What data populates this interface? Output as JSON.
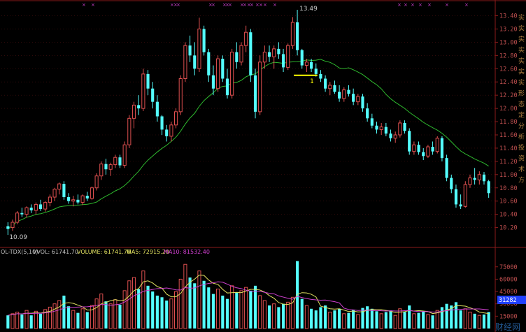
{
  "colors": {
    "background": "#000000",
    "frame": "#8b1a1a",
    "grid": "#4a1010",
    "up": "#e05050",
    "down": "#54ffff",
    "ma": "#2eb82e",
    "vol_ma5": "#e0e060",
    "vol_ma10": "#d040d0",
    "label": "#c05050",
    "marker": "#ffff00",
    "badge": "#2040ff"
  },
  "price_axis": {
    "ticks": [
      "13.40",
      "13.20",
      "13.00",
      "12.80",
      "12.60",
      "12.40",
      "12.20",
      "12.00",
      "11.80",
      "11.60",
      "11.40",
      "11.20",
      "11.00",
      "10.80",
      "10.60",
      "10.40",
      "10.20"
    ],
    "high_label": "13.49",
    "low_label": "10.09",
    "marker_label": "1"
  },
  "indicator_header": {
    "name": "OL-TDX(5,10)",
    "vvol": "VVOL: 61741.70",
    "volume": "VOLUME: 61741.70",
    "ma5": "MA5: 72915.20",
    "ma10": "MA10: 81532.40"
  },
  "volume_axis": {
    "ticks": [
      "75000",
      "60000",
      "45000",
      "30000",
      "15000"
    ],
    "badge": "31282"
  },
  "side_labels": [
    "实",
    "实",
    "实",
    "实",
    "实",
    "实",
    "实",
    "形",
    "态",
    "定",
    "分",
    "析",
    "投",
    "资",
    "术",
    "方"
  ],
  "watermark": "财经网",
  "chart_data": {
    "type": "candlestick",
    "price_range": [
      10.09,
      13.49
    ],
    "volume_range": [
      0,
      85000
    ],
    "ma_period": 20,
    "candles": [
      {
        "o": 10.22,
        "h": 10.28,
        "l": 10.09,
        "c": 10.18,
        "v": 16000
      },
      {
        "o": 10.2,
        "h": 10.32,
        "l": 10.15,
        "c": 10.28,
        "v": 18000
      },
      {
        "o": 10.28,
        "h": 10.45,
        "l": 10.25,
        "c": 10.42,
        "v": 20000
      },
      {
        "o": 10.42,
        "h": 10.5,
        "l": 10.36,
        "c": 10.4,
        "v": 17000
      },
      {
        "o": 10.4,
        "h": 10.52,
        "l": 10.35,
        "c": 10.5,
        "v": 22000
      },
      {
        "o": 10.5,
        "h": 10.55,
        "l": 10.42,
        "c": 10.46,
        "v": 16000
      },
      {
        "o": 10.46,
        "h": 10.58,
        "l": 10.4,
        "c": 10.55,
        "v": 21000
      },
      {
        "o": 10.55,
        "h": 10.62,
        "l": 10.45,
        "c": 10.48,
        "v": 18000
      },
      {
        "o": 10.48,
        "h": 10.6,
        "l": 10.44,
        "c": 10.58,
        "v": 23000
      },
      {
        "o": 10.58,
        "h": 10.7,
        "l": 10.52,
        "c": 10.66,
        "v": 26000
      },
      {
        "o": 10.66,
        "h": 10.8,
        "l": 10.6,
        "c": 10.78,
        "v": 30000
      },
      {
        "o": 10.78,
        "h": 10.88,
        "l": 10.7,
        "c": 10.86,
        "v": 34000
      },
      {
        "o": 10.86,
        "h": 10.9,
        "l": 10.62,
        "c": 10.66,
        "v": 40000
      },
      {
        "o": 10.66,
        "h": 10.72,
        "l": 10.56,
        "c": 10.6,
        "v": 27000
      },
      {
        "o": 10.6,
        "h": 10.68,
        "l": 10.52,
        "c": 10.62,
        "v": 22000
      },
      {
        "o": 10.62,
        "h": 10.7,
        "l": 10.55,
        "c": 10.58,
        "v": 19000
      },
      {
        "o": 10.58,
        "h": 10.7,
        "l": 10.54,
        "c": 10.68,
        "v": 24000
      },
      {
        "o": 10.68,
        "h": 10.74,
        "l": 10.6,
        "c": 10.64,
        "v": 20000
      },
      {
        "o": 10.64,
        "h": 10.82,
        "l": 10.62,
        "c": 10.8,
        "v": 28000
      },
      {
        "o": 10.8,
        "h": 11.02,
        "l": 10.76,
        "c": 10.98,
        "v": 36000
      },
      {
        "o": 10.98,
        "h": 11.2,
        "l": 10.92,
        "c": 11.16,
        "v": 42000
      },
      {
        "o": 11.16,
        "h": 11.24,
        "l": 11.0,
        "c": 11.08,
        "v": 33000
      },
      {
        "o": 11.08,
        "h": 11.18,
        "l": 10.98,
        "c": 11.15,
        "v": 30000
      },
      {
        "o": 11.15,
        "h": 11.3,
        "l": 11.1,
        "c": 11.26,
        "v": 35000
      },
      {
        "o": 11.26,
        "h": 11.3,
        "l": 11.1,
        "c": 11.14,
        "v": 29000
      },
      {
        "o": 11.14,
        "h": 11.5,
        "l": 11.1,
        "c": 11.45,
        "v": 46000
      },
      {
        "o": 11.45,
        "h": 11.9,
        "l": 11.4,
        "c": 11.85,
        "v": 58000
      },
      {
        "o": 11.85,
        "h": 12.1,
        "l": 11.7,
        "c": 12.05,
        "v": 62000
      },
      {
        "o": 12.05,
        "h": 12.2,
        "l": 11.9,
        "c": 12.0,
        "v": 48000
      },
      {
        "o": 12.0,
        "h": 12.6,
        "l": 11.96,
        "c": 12.52,
        "v": 70000
      },
      {
        "o": 12.52,
        "h": 12.58,
        "l": 12.2,
        "c": 12.3,
        "v": 52000
      },
      {
        "o": 12.3,
        "h": 12.4,
        "l": 12.0,
        "c": 12.1,
        "v": 45000
      },
      {
        "o": 12.1,
        "h": 12.2,
        "l": 11.8,
        "c": 11.88,
        "v": 40000
      },
      {
        "o": 11.88,
        "h": 11.9,
        "l": 11.6,
        "c": 11.68,
        "v": 38000
      },
      {
        "o": 11.68,
        "h": 11.75,
        "l": 11.5,
        "c": 11.58,
        "v": 34000
      },
      {
        "o": 11.58,
        "h": 11.8,
        "l": 11.5,
        "c": 11.75,
        "v": 36000
      },
      {
        "o": 11.75,
        "h": 12.0,
        "l": 11.7,
        "c": 11.95,
        "v": 45000
      },
      {
        "o": 11.95,
        "h": 12.5,
        "l": 11.9,
        "c": 12.45,
        "v": 60000
      },
      {
        "o": 12.45,
        "h": 13.0,
        "l": 12.4,
        "c": 12.95,
        "v": 78000
      },
      {
        "o": 12.95,
        "h": 13.1,
        "l": 12.7,
        "c": 12.8,
        "v": 62000
      },
      {
        "o": 12.8,
        "h": 13.0,
        "l": 12.5,
        "c": 12.6,
        "v": 55000
      },
      {
        "o": 12.6,
        "h": 13.37,
        "l": 12.55,
        "c": 13.2,
        "v": 70000
      },
      {
        "o": 13.2,
        "h": 13.25,
        "l": 12.8,
        "c": 12.85,
        "v": 58000
      },
      {
        "o": 12.85,
        "h": 12.9,
        "l": 12.4,
        "c": 12.5,
        "v": 50000
      },
      {
        "o": 12.5,
        "h": 12.65,
        "l": 12.2,
        "c": 12.3,
        "v": 42000
      },
      {
        "o": 12.3,
        "h": 12.8,
        "l": 12.25,
        "c": 12.75,
        "v": 48000
      },
      {
        "o": 12.75,
        "h": 12.8,
        "l": 12.4,
        "c": 12.45,
        "v": 40000
      },
      {
        "o": 12.45,
        "h": 12.6,
        "l": 12.15,
        "c": 12.2,
        "v": 36000
      },
      {
        "o": 12.2,
        "h": 12.9,
        "l": 12.15,
        "c": 12.85,
        "v": 52000
      },
      {
        "o": 12.85,
        "h": 13.0,
        "l": 12.6,
        "c": 12.7,
        "v": 44000
      },
      {
        "o": 12.7,
        "h": 13.0,
        "l": 12.65,
        "c": 12.95,
        "v": 46000
      },
      {
        "o": 12.95,
        "h": 13.25,
        "l": 12.85,
        "c": 13.15,
        "v": 50000
      },
      {
        "o": 13.15,
        "h": 13.2,
        "l": 12.4,
        "c": 12.5,
        "v": 46000
      },
      {
        "o": 12.5,
        "h": 12.6,
        "l": 11.85,
        "c": 11.95,
        "v": 52000
      },
      {
        "o": 11.95,
        "h": 12.8,
        "l": 11.9,
        "c": 12.7,
        "v": 40000
      },
      {
        "o": 12.7,
        "h": 12.95,
        "l": 12.6,
        "c": 12.85,
        "v": 34000
      },
      {
        "o": 12.85,
        "h": 12.95,
        "l": 12.7,
        "c": 12.78,
        "v": 28000
      },
      {
        "o": 12.78,
        "h": 12.95,
        "l": 12.6,
        "c": 12.9,
        "v": 30000
      },
      {
        "o": 12.9,
        "h": 13.0,
        "l": 12.75,
        "c": 12.82,
        "v": 26000
      },
      {
        "o": 12.82,
        "h": 12.9,
        "l": 12.55,
        "c": 12.62,
        "v": 30000
      },
      {
        "o": 12.62,
        "h": 12.98,
        "l": 12.58,
        "c": 12.95,
        "v": 32000
      },
      {
        "o": 12.95,
        "h": 13.38,
        "l": 12.9,
        "c": 13.3,
        "v": 38000
      },
      {
        "o": 13.3,
        "h": 13.49,
        "l": 12.8,
        "c": 12.88,
        "v": 82000
      },
      {
        "o": 12.88,
        "h": 12.9,
        "l": 12.6,
        "c": 12.65,
        "v": 36000
      },
      {
        "o": 12.65,
        "h": 12.75,
        "l": 12.55,
        "c": 12.7,
        "v": 28000
      },
      {
        "o": 12.7,
        "h": 12.75,
        "l": 12.55,
        "c": 12.6,
        "v": 24000
      },
      {
        "o": 12.6,
        "h": 12.68,
        "l": 12.48,
        "c": 12.52,
        "v": 22000
      },
      {
        "o": 12.52,
        "h": 12.58,
        "l": 12.4,
        "c": 12.45,
        "v": 26000
      },
      {
        "o": 12.45,
        "h": 12.5,
        "l": 12.25,
        "c": 12.3,
        "v": 28000
      },
      {
        "o": 12.3,
        "h": 12.4,
        "l": 12.2,
        "c": 12.35,
        "v": 20000
      },
      {
        "o": 12.35,
        "h": 12.42,
        "l": 12.22,
        "c": 12.25,
        "v": 22000
      },
      {
        "o": 12.25,
        "h": 12.35,
        "l": 12.1,
        "c": 12.15,
        "v": 24000
      },
      {
        "o": 12.15,
        "h": 12.32,
        "l": 12.1,
        "c": 12.28,
        "v": 18000
      },
      {
        "o": 12.28,
        "h": 12.35,
        "l": 12.18,
        "c": 12.22,
        "v": 19000
      },
      {
        "o": 12.22,
        "h": 12.3,
        "l": 12.05,
        "c": 12.1,
        "v": 23000
      },
      {
        "o": 12.1,
        "h": 12.22,
        "l": 12.05,
        "c": 12.18,
        "v": 17000
      },
      {
        "o": 12.18,
        "h": 12.22,
        "l": 11.95,
        "c": 12.0,
        "v": 25000
      },
      {
        "o": 12.0,
        "h": 12.08,
        "l": 11.8,
        "c": 11.85,
        "v": 27000
      },
      {
        "o": 11.85,
        "h": 11.92,
        "l": 11.7,
        "c": 11.74,
        "v": 24000
      },
      {
        "o": 11.74,
        "h": 11.8,
        "l": 11.62,
        "c": 11.68,
        "v": 21000
      },
      {
        "o": 11.68,
        "h": 11.78,
        "l": 11.6,
        "c": 11.72,
        "v": 18000
      },
      {
        "o": 11.72,
        "h": 11.78,
        "l": 11.58,
        "c": 11.62,
        "v": 20000
      },
      {
        "o": 11.62,
        "h": 11.68,
        "l": 11.5,
        "c": 11.55,
        "v": 22000
      },
      {
        "o": 11.55,
        "h": 11.65,
        "l": 11.48,
        "c": 11.6,
        "v": 16000
      },
      {
        "o": 11.6,
        "h": 11.82,
        "l": 11.56,
        "c": 11.78,
        "v": 24000
      },
      {
        "o": 11.78,
        "h": 11.82,
        "l": 11.62,
        "c": 11.66,
        "v": 20000
      },
      {
        "o": 11.66,
        "h": 11.7,
        "l": 11.3,
        "c": 11.35,
        "v": 28000
      },
      {
        "o": 11.35,
        "h": 11.5,
        "l": 11.3,
        "c": 11.45,
        "v": 18000
      },
      {
        "o": 11.45,
        "h": 11.5,
        "l": 11.3,
        "c": 11.34,
        "v": 19000
      },
      {
        "o": 11.34,
        "h": 11.4,
        "l": 11.22,
        "c": 11.28,
        "v": 21000
      },
      {
        "o": 11.28,
        "h": 11.45,
        "l": 11.25,
        "c": 11.42,
        "v": 17000
      },
      {
        "o": 11.42,
        "h": 11.5,
        "l": 11.3,
        "c": 11.35,
        "v": 16000
      },
      {
        "o": 11.35,
        "h": 11.58,
        "l": 11.32,
        "c": 11.55,
        "v": 22000
      },
      {
        "o": 11.55,
        "h": 11.58,
        "l": 11.2,
        "c": 11.25,
        "v": 26000
      },
      {
        "o": 11.25,
        "h": 11.3,
        "l": 10.9,
        "c": 10.95,
        "v": 30000
      },
      {
        "o": 10.95,
        "h": 11.0,
        "l": 10.72,
        "c": 10.78,
        "v": 28000
      },
      {
        "o": 10.78,
        "h": 10.85,
        "l": 10.5,
        "c": 10.55,
        "v": 32000
      },
      {
        "o": 10.55,
        "h": 10.7,
        "l": 10.48,
        "c": 10.52,
        "v": 22000
      },
      {
        "o": 10.52,
        "h": 10.9,
        "l": 10.5,
        "c": 10.85,
        "v": 24000
      },
      {
        "o": 10.85,
        "h": 11.0,
        "l": 10.8,
        "c": 10.95,
        "v": 20000
      },
      {
        "o": 10.95,
        "h": 11.1,
        "l": 10.85,
        "c": 10.92,
        "v": 18000
      },
      {
        "o": 10.92,
        "h": 11.05,
        "l": 10.85,
        "c": 11.0,
        "v": 16000
      },
      {
        "o": 11.0,
        "h": 11.04,
        "l": 10.85,
        "c": 10.9,
        "v": 17000
      },
      {
        "o": 10.9,
        "h": 10.92,
        "l": 10.65,
        "c": 10.72,
        "v": 20000
      }
    ]
  }
}
